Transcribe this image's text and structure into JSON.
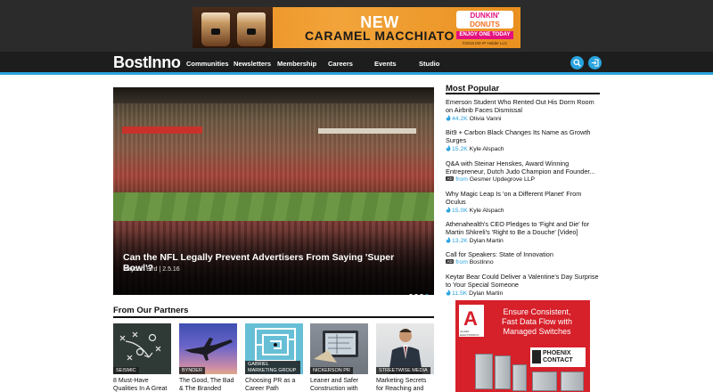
{
  "top_ad": {
    "headline_new": "NEW",
    "product": "CARAMEL MACCHIATO",
    "brand_line1": "DUNKIN'",
    "brand_line2": "DONUTS",
    "cta": "ENJOY ONE TODAY",
    "copyright": "©2016 DD IP Holder LLC"
  },
  "nav": {
    "logo": "BostInno",
    "items": [
      "Communities",
      "Newsletters",
      "Membership",
      "Careers",
      "Events",
      "Studio"
    ],
    "search_icon": "search-icon",
    "login_icon": "login-icon",
    "accent_color": "#29a3de"
  },
  "hero": {
    "title": "Can the NFL Legally Prevent Advertisers From Saying 'Super Bowl'?",
    "meta": "Hayden Bird | 2.5.16",
    "slides": 4,
    "active_slide": 4
  },
  "partners": {
    "title": "From Our Partners",
    "items": [
      {
        "tag": "SEISMIC",
        "text": "8 Must-Have Qualities In A Great"
      },
      {
        "tag": "BYNDER",
        "text": "The Good, The Bad & The Branded"
      },
      {
        "tag": "GABRIEL MARKETING GROUP",
        "text": "Choosing PR as a Career Path"
      },
      {
        "tag": "NICKERSON PR",
        "text": "Leaner and Safer Construction with"
      },
      {
        "tag": "STREETWISE MEDIA",
        "text": "Marketing Secrets for Reaching and"
      }
    ]
  },
  "popular": {
    "title": "Most Popular",
    "items": [
      {
        "headline": "Emerson Student Who Rented Out His Dorm Room on Airbnb Faces Dismissal",
        "count": "44.2K",
        "author": "Olivia Vanni"
      },
      {
        "headline": "Bit9 + Carbon Black Changes Its Name as Growth Surges",
        "count": "15.2K",
        "author": "Kyle Alspach"
      },
      {
        "headline": "Q&A with Steinar Henskes, Award Winning Entrepreneur, Dutch Judo Champion and Founder...",
        "badge": "AD",
        "from": "from",
        "author": "Gesmer Updegrove LLP"
      },
      {
        "headline": "Why Magic Leap Is 'on a Different Planet' From Oculus",
        "count": "15.0K",
        "author": "Kyle Alspach"
      },
      {
        "headline": "Athenahealth's CEO Pledges to 'Fight and Die' for Martin Shkreli's 'Right to Be a Douche' [Video]",
        "count": "13.2K",
        "author": "Dylan Martin"
      },
      {
        "headline": "Call for Speakers: State of Innovation",
        "badge": "AD",
        "from": "from",
        "author": "BostInno"
      },
      {
        "headline": "Keytar Bear Could Deliver a Valentine's Day Surprise to Your Special Someone",
        "count": "11.5K",
        "author": "Dylan Martin"
      }
    ]
  },
  "side_ad": {
    "copy_line1": "Ensure Consistent,",
    "copy_line2": "Fast Data Flow with",
    "copy_line3": "Managed Switches",
    "logo_letter": "A",
    "logo_text": "ALLIED ELECTRONICS",
    "partner_line1": "PHOENIX",
    "partner_line2": "CONTACT"
  }
}
